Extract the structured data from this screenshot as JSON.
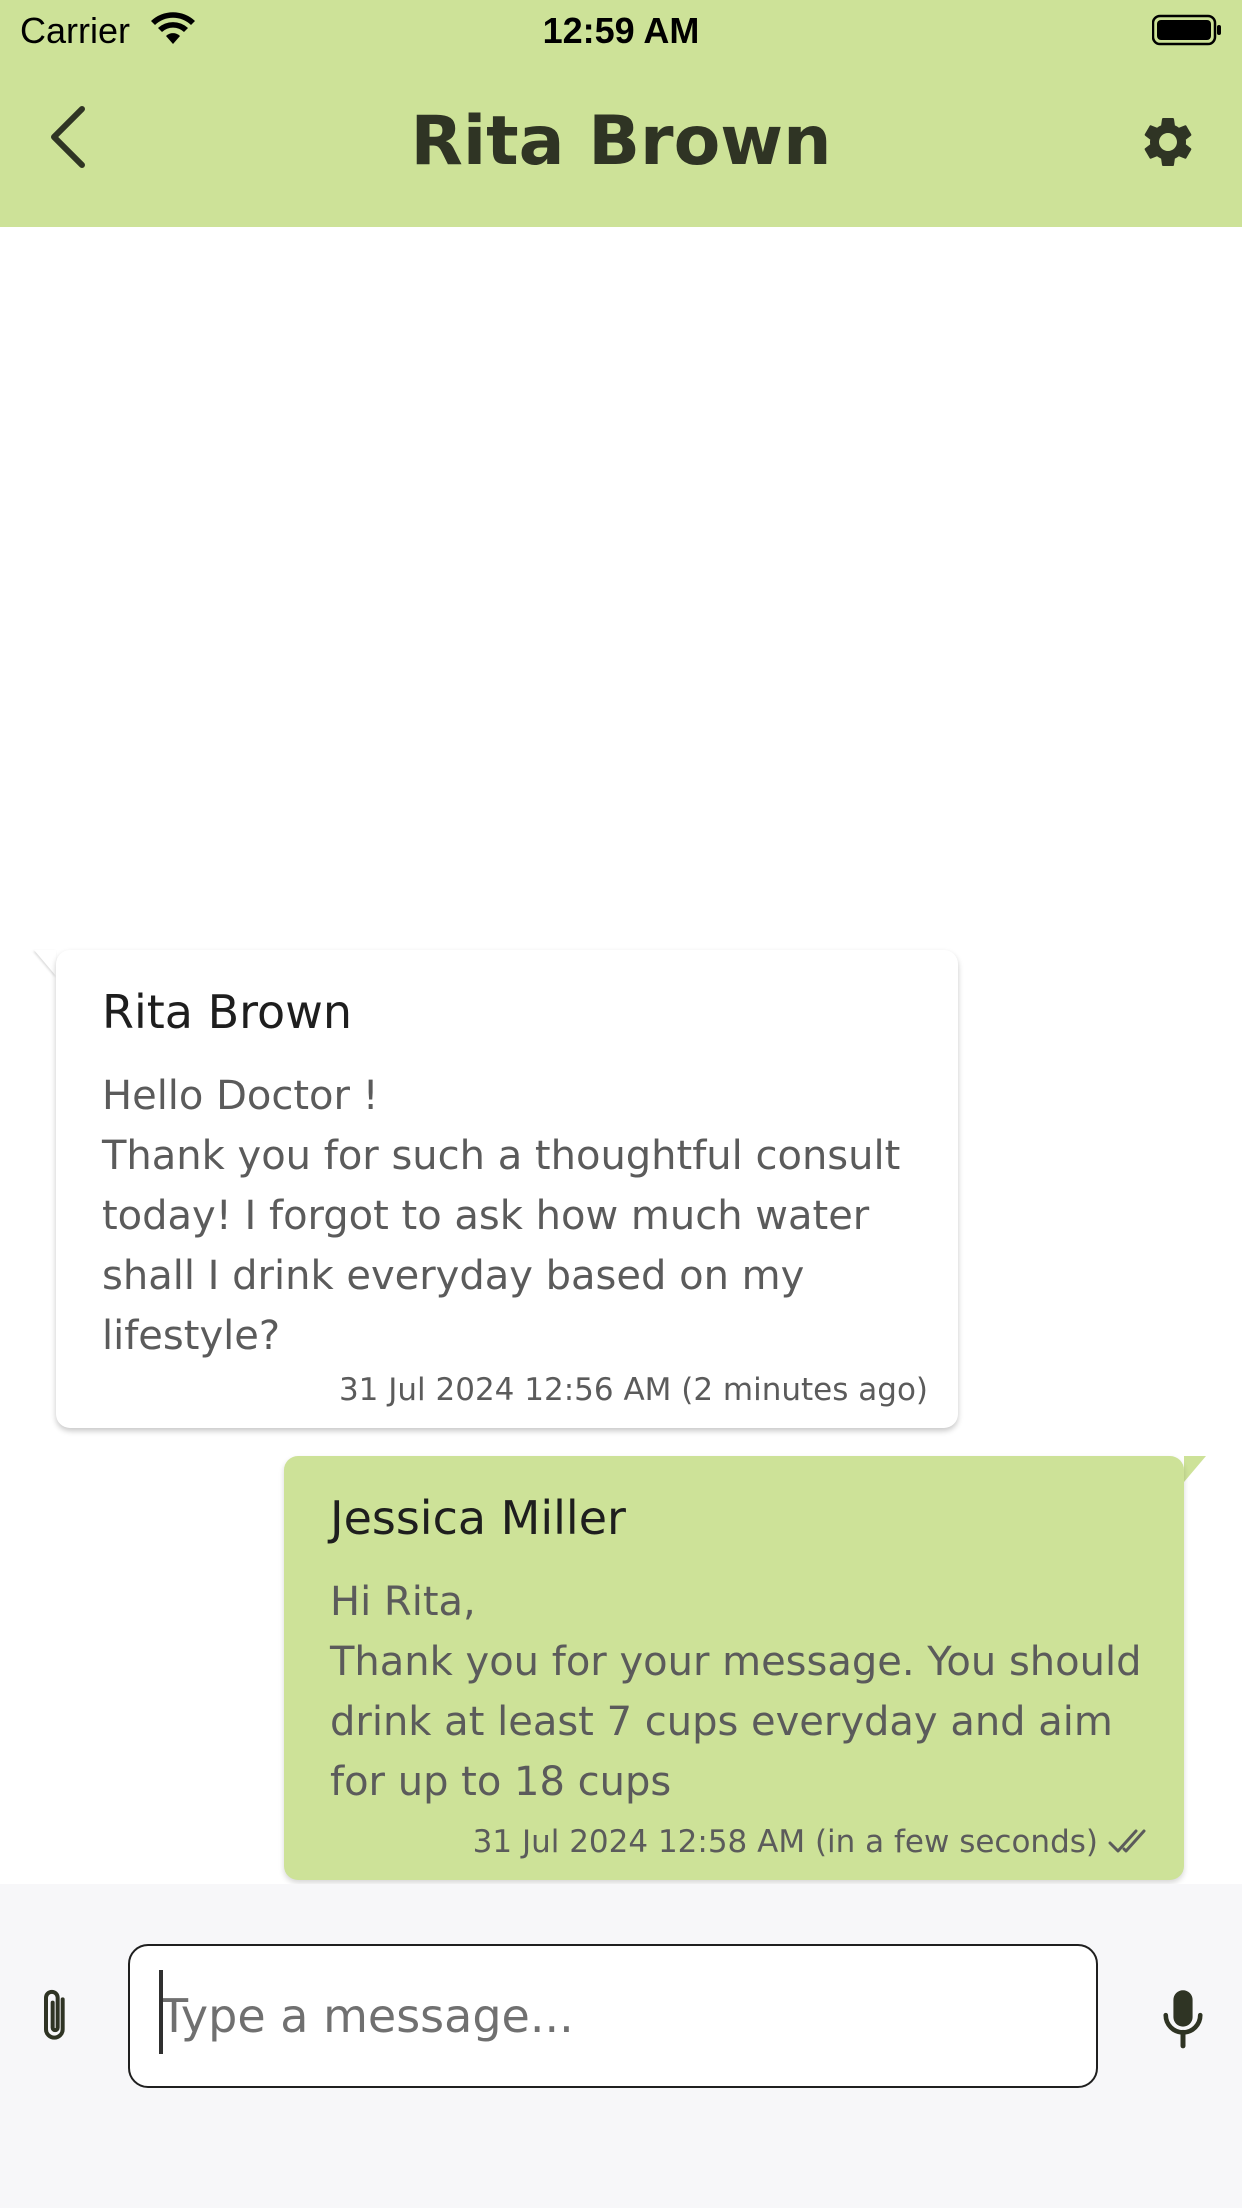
{
  "status_bar": {
    "carrier": "Carrier",
    "time": "12:59 AM"
  },
  "header": {
    "title": "Rita Brown",
    "back_icon": "chevron-left-icon",
    "settings_icon": "gear-icon"
  },
  "colors": {
    "accent": "#cde298",
    "title_text": "#2f3424",
    "body_text": "#5b5b5b"
  },
  "messages": [
    {
      "direction": "incoming",
      "sender": "Rita Brown",
      "lines": [
        "Hello Doctor !",
        "Thank you for such a thoughtful consult",
        "today! I forgot to ask how much water",
        "shall I drink everyday based on my",
        "lifestyle?"
      ],
      "timestamp": "31 Jul 2024 12:56 AM (2 minutes ago)"
    },
    {
      "direction": "outgoing",
      "sender": "Jessica Miller",
      "lines": [
        "Hi Rita,",
        "Thank you for your message. You should",
        "drink at least 7 cups everyday and aim",
        "for up to 18 cups"
      ],
      "timestamp": "31 Jul 2024 12:58 AM (in a few seconds)",
      "status_icon": "double-check-icon"
    }
  ],
  "composer": {
    "placeholder": "Type a message...",
    "value": "",
    "attach_icon": "paperclip-icon",
    "mic_icon": "microphone-icon"
  }
}
